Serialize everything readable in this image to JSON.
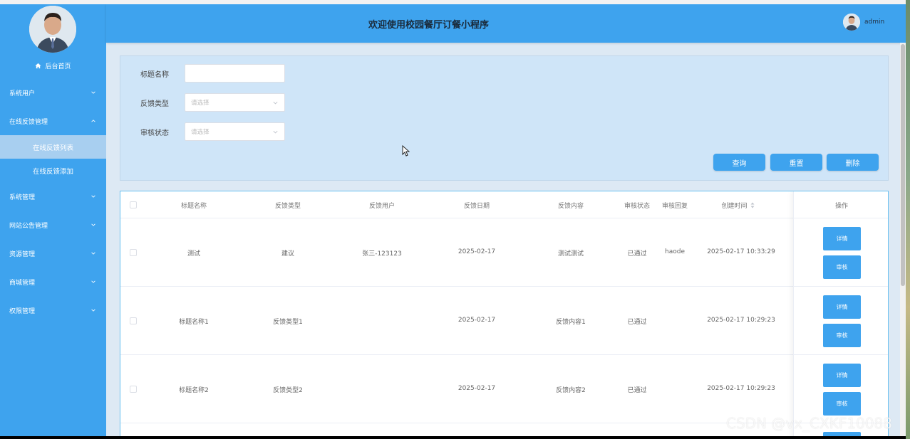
{
  "header": {
    "title": "欢迎使用校园餐厅订餐小程序",
    "username": "admin"
  },
  "sidebar": {
    "home_label": "后台首页",
    "items": [
      {
        "label": "系统用户",
        "expanded": false
      },
      {
        "label": "在线反馈管理",
        "expanded": true,
        "children": [
          "在线反馈列表",
          "在线反馈添加"
        ]
      },
      {
        "label": "系统管理",
        "expanded": false
      },
      {
        "label": "网站公告管理",
        "expanded": false
      },
      {
        "label": "资源管理",
        "expanded": false
      },
      {
        "label": "商城管理",
        "expanded": false
      },
      {
        "label": "权限管理",
        "expanded": false
      }
    ],
    "active_child": "在线反馈列表"
  },
  "search": {
    "title_label": "标题名称",
    "title_value": "",
    "type_label": "反馈类型",
    "type_placeholder": "请选择",
    "status_label": "审核状态",
    "status_placeholder": "请选择",
    "query_button": "查询",
    "reset_button": "重置",
    "delete_button": "删除"
  },
  "table": {
    "columns": [
      "标题名称",
      "反馈类型",
      "反馈用户",
      "反馈日期",
      "反馈内容",
      "审核状态",
      "审核回复",
      "创建时间",
      "操作"
    ],
    "rows": [
      {
        "title": "测试",
        "type": "建议",
        "user": "张三-123123",
        "date": "2025-02-17",
        "content": "测试测试",
        "status": "已通过",
        "reply": "haode",
        "created": "2025-02-17 10:33:29"
      },
      {
        "title": "标题名称1",
        "type": "反馈类型1",
        "user": "",
        "date": "2025-02-17",
        "content": "反馈内容1",
        "status": "已通过",
        "reply": "",
        "created": "2025-02-17 10:29:23"
      },
      {
        "title": "标题名称2",
        "type": "反馈类型2",
        "user": "",
        "date": "2025-02-17",
        "content": "反馈内容2",
        "status": "已通过",
        "reply": "",
        "created": "2025-02-17 10:29:23"
      }
    ],
    "detail_button": "详情",
    "review_button": "审核"
  },
  "watermark": "CSDN @vx_CXKF10088",
  "colors": {
    "primary": "#3ea3ee",
    "panel": "#cfe5f8",
    "active_menu": "#a8cff0"
  },
  "icons": [
    "home-icon",
    "chevron-down-icon",
    "chevron-up-icon",
    "sort-icon",
    "cursor-icon"
  ]
}
